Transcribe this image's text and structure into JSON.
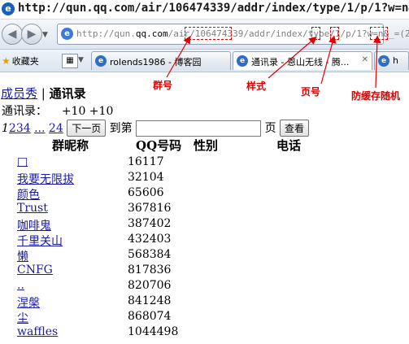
{
  "window": {
    "title": "http://qun.qq.com/air/106474339/addr/index/type/1/p/1?w=n&_="
  },
  "address_bar": {
    "url_prefix": "http://qun.",
    "url_domain": "qq.com",
    "url_rest": "/air/106474339/addr/index/type/1/p/1?w=n&_=(2)"
  },
  "favorites": {
    "label": "收藏夹",
    "grid_icon": "grid-icon"
  },
  "tabs": [
    {
      "label": "rolends1986 - 博客园"
    },
    {
      "label": "通讯录 - 恩山无线 - 腾..."
    },
    {
      "label": "h"
    }
  ],
  "annotations": {
    "group_number": "群号",
    "style": "样式",
    "page_number": "页号",
    "anti_cache": "防缓存随机"
  },
  "page": {
    "nav_members": "成员秀",
    "separator": "|",
    "nav_contacts": "通讯录",
    "contacts_label": "通讯录：",
    "contacts_value": "+10 +10",
    "pager_current": "1",
    "pager_links": "234",
    "pager_ellipsis": "...",
    "pager_last": "24",
    "next_button": "下一页",
    "goto_label": "到第",
    "goto_value": "",
    "page_unit": "页",
    "view_button": "查看",
    "col_nick": "群昵称",
    "col_qq": "QQ号码",
    "col_gender": "性别",
    "col_phone": "电话"
  },
  "members": [
    {
      "nick": "□",
      "qq": "16117"
    },
    {
      "nick": "我要无限拔",
      "qq": "32104"
    },
    {
      "nick": "颜色",
      "qq": "65606"
    },
    {
      "nick": "Trust",
      "qq": "367816"
    },
    {
      "nick": "咖啡鬼",
      "qq": "387402"
    },
    {
      "nick": "千里关山",
      "qq": "432403"
    },
    {
      "nick": "懒",
      "qq": "568384"
    },
    {
      "nick": "CNFG",
      "qq": "817836"
    },
    {
      "nick": "..",
      "qq": "820706"
    },
    {
      "nick": "涅槃",
      "qq": "841248"
    },
    {
      "nick": "尘",
      "qq": "868074"
    },
    {
      "nick": "waffles",
      "qq": "1044498"
    }
  ],
  "colors": {
    "annotation": "#e00000",
    "link": "#1a1aa6"
  }
}
